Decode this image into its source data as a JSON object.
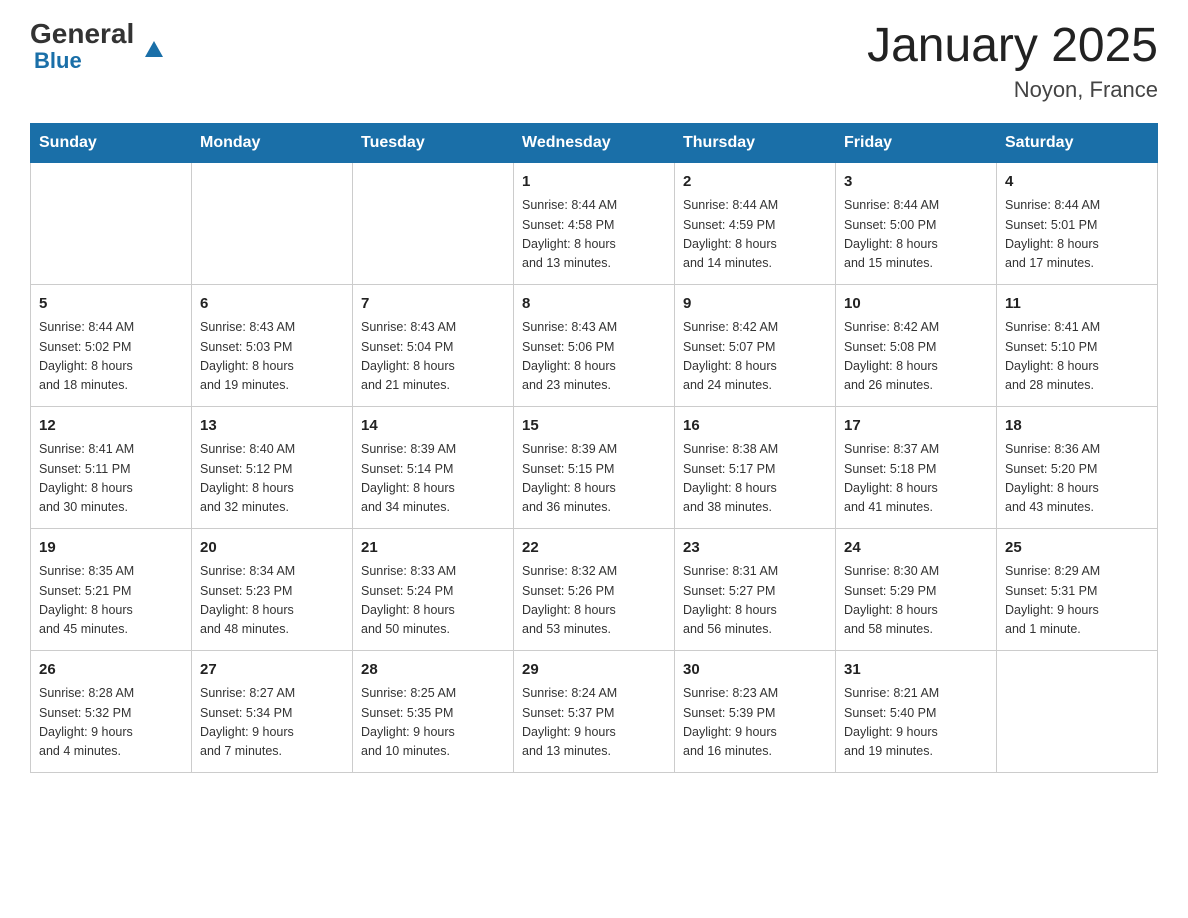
{
  "header": {
    "logo_general": "General",
    "logo_blue": "Blue",
    "title": "January 2025",
    "location": "Noyon, France"
  },
  "days_of_week": [
    "Sunday",
    "Monday",
    "Tuesday",
    "Wednesday",
    "Thursday",
    "Friday",
    "Saturday"
  ],
  "weeks": [
    [
      {
        "day": "",
        "info": ""
      },
      {
        "day": "",
        "info": ""
      },
      {
        "day": "",
        "info": ""
      },
      {
        "day": "1",
        "info": "Sunrise: 8:44 AM\nSunset: 4:58 PM\nDaylight: 8 hours\nand 13 minutes."
      },
      {
        "day": "2",
        "info": "Sunrise: 8:44 AM\nSunset: 4:59 PM\nDaylight: 8 hours\nand 14 minutes."
      },
      {
        "day": "3",
        "info": "Sunrise: 8:44 AM\nSunset: 5:00 PM\nDaylight: 8 hours\nand 15 minutes."
      },
      {
        "day": "4",
        "info": "Sunrise: 8:44 AM\nSunset: 5:01 PM\nDaylight: 8 hours\nand 17 minutes."
      }
    ],
    [
      {
        "day": "5",
        "info": "Sunrise: 8:44 AM\nSunset: 5:02 PM\nDaylight: 8 hours\nand 18 minutes."
      },
      {
        "day": "6",
        "info": "Sunrise: 8:43 AM\nSunset: 5:03 PM\nDaylight: 8 hours\nand 19 minutes."
      },
      {
        "day": "7",
        "info": "Sunrise: 8:43 AM\nSunset: 5:04 PM\nDaylight: 8 hours\nand 21 minutes."
      },
      {
        "day": "8",
        "info": "Sunrise: 8:43 AM\nSunset: 5:06 PM\nDaylight: 8 hours\nand 23 minutes."
      },
      {
        "day": "9",
        "info": "Sunrise: 8:42 AM\nSunset: 5:07 PM\nDaylight: 8 hours\nand 24 minutes."
      },
      {
        "day": "10",
        "info": "Sunrise: 8:42 AM\nSunset: 5:08 PM\nDaylight: 8 hours\nand 26 minutes."
      },
      {
        "day": "11",
        "info": "Sunrise: 8:41 AM\nSunset: 5:10 PM\nDaylight: 8 hours\nand 28 minutes."
      }
    ],
    [
      {
        "day": "12",
        "info": "Sunrise: 8:41 AM\nSunset: 5:11 PM\nDaylight: 8 hours\nand 30 minutes."
      },
      {
        "day": "13",
        "info": "Sunrise: 8:40 AM\nSunset: 5:12 PM\nDaylight: 8 hours\nand 32 minutes."
      },
      {
        "day": "14",
        "info": "Sunrise: 8:39 AM\nSunset: 5:14 PM\nDaylight: 8 hours\nand 34 minutes."
      },
      {
        "day": "15",
        "info": "Sunrise: 8:39 AM\nSunset: 5:15 PM\nDaylight: 8 hours\nand 36 minutes."
      },
      {
        "day": "16",
        "info": "Sunrise: 8:38 AM\nSunset: 5:17 PM\nDaylight: 8 hours\nand 38 minutes."
      },
      {
        "day": "17",
        "info": "Sunrise: 8:37 AM\nSunset: 5:18 PM\nDaylight: 8 hours\nand 41 minutes."
      },
      {
        "day": "18",
        "info": "Sunrise: 8:36 AM\nSunset: 5:20 PM\nDaylight: 8 hours\nand 43 minutes."
      }
    ],
    [
      {
        "day": "19",
        "info": "Sunrise: 8:35 AM\nSunset: 5:21 PM\nDaylight: 8 hours\nand 45 minutes."
      },
      {
        "day": "20",
        "info": "Sunrise: 8:34 AM\nSunset: 5:23 PM\nDaylight: 8 hours\nand 48 minutes."
      },
      {
        "day": "21",
        "info": "Sunrise: 8:33 AM\nSunset: 5:24 PM\nDaylight: 8 hours\nand 50 minutes."
      },
      {
        "day": "22",
        "info": "Sunrise: 8:32 AM\nSunset: 5:26 PM\nDaylight: 8 hours\nand 53 minutes."
      },
      {
        "day": "23",
        "info": "Sunrise: 8:31 AM\nSunset: 5:27 PM\nDaylight: 8 hours\nand 56 minutes."
      },
      {
        "day": "24",
        "info": "Sunrise: 8:30 AM\nSunset: 5:29 PM\nDaylight: 8 hours\nand 58 minutes."
      },
      {
        "day": "25",
        "info": "Sunrise: 8:29 AM\nSunset: 5:31 PM\nDaylight: 9 hours\nand 1 minute."
      }
    ],
    [
      {
        "day": "26",
        "info": "Sunrise: 8:28 AM\nSunset: 5:32 PM\nDaylight: 9 hours\nand 4 minutes."
      },
      {
        "day": "27",
        "info": "Sunrise: 8:27 AM\nSunset: 5:34 PM\nDaylight: 9 hours\nand 7 minutes."
      },
      {
        "day": "28",
        "info": "Sunrise: 8:25 AM\nSunset: 5:35 PM\nDaylight: 9 hours\nand 10 minutes."
      },
      {
        "day": "29",
        "info": "Sunrise: 8:24 AM\nSunset: 5:37 PM\nDaylight: 9 hours\nand 13 minutes."
      },
      {
        "day": "30",
        "info": "Sunrise: 8:23 AM\nSunset: 5:39 PM\nDaylight: 9 hours\nand 16 minutes."
      },
      {
        "day": "31",
        "info": "Sunrise: 8:21 AM\nSunset: 5:40 PM\nDaylight: 9 hours\nand 19 minutes."
      },
      {
        "day": "",
        "info": ""
      }
    ]
  ]
}
